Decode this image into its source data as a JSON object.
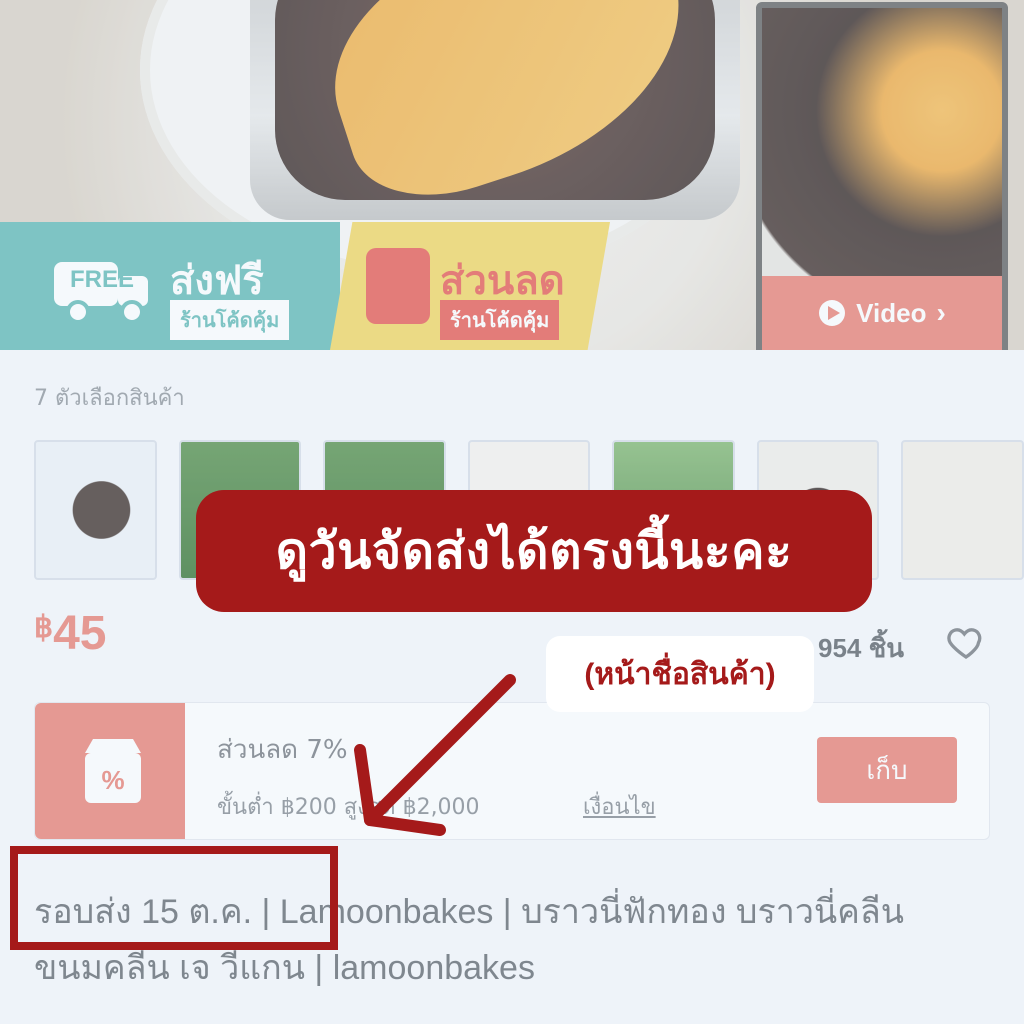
{
  "banner": {
    "free_label": "FREE",
    "free_ship_text": "ส่งฟรี",
    "free_ship_sub": "ร้านโค้ดคุ้ม",
    "discount_text": "ส่วนลด",
    "discount_sub": "ร้านโค้ดคุ้ม",
    "video_label": "Video"
  },
  "variants": {
    "label": "7 ตัวเลือกสินค้า",
    "count": 7
  },
  "price": {
    "currency": "฿",
    "value": "45"
  },
  "stock": {
    "text": "954 ชิ้น"
  },
  "coupon": {
    "title": "ส่วนลด 7%",
    "condition": "ขั้นต่ำ ฿200 สูงสุด ฿2,000",
    "terms_link": "เงื่อนไข",
    "collect_button": "เก็บ"
  },
  "product": {
    "name": "รอบส่ง 15 ต.ค. | Lamoonbakes | บราวนี่ฟักทอง บราวนี่คลีน ขนมคลีน เจ วีแกน | lamoonbakes"
  },
  "annotation": {
    "callout": "ดูวันจัดส่งได้ตรงนี้นะคะ",
    "note": "(หน้าชื่อสินค้า)"
  },
  "colors": {
    "accent": "#e97b6e",
    "annotation": "#a51a1a",
    "teal": "#5ab6b2",
    "yellow": "#f1d45b"
  }
}
